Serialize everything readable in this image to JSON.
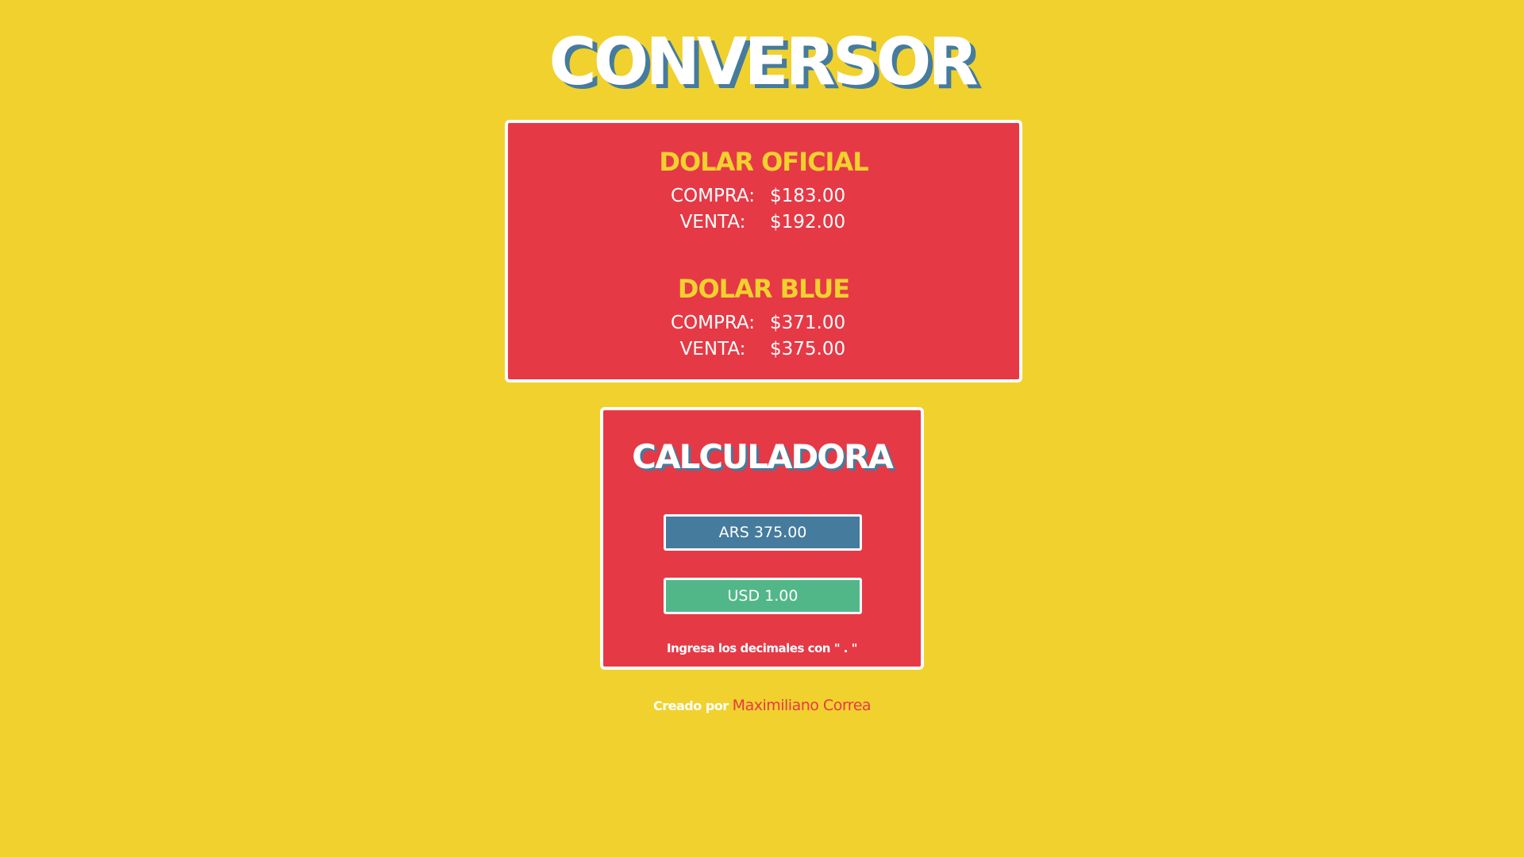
{
  "header": {
    "title": "CONVERSOR"
  },
  "rates": {
    "oficial": {
      "title": "DOLAR OFICIAL",
      "buy_label": "COMPRA:",
      "buy_value": "$183.00",
      "sell_label": "VENTA:",
      "sell_value": "$192.00"
    },
    "blue": {
      "title": "DOLAR BLUE",
      "buy_label": "COMPRA:",
      "buy_value": "$371.00",
      "sell_label": "VENTA:",
      "sell_value": "$375.00"
    }
  },
  "calculator": {
    "title": "CALCULADORA",
    "ars_placeholder": "ARS 375.00",
    "usd_placeholder": "USD 1.00",
    "note": "Ingresa los decimales con \" . \""
  },
  "footer": {
    "prefix": "Creado por",
    "author": "Maximiliano Correa"
  },
  "colors": {
    "background": "#f1d12e",
    "card": "#e63946",
    "ars_field": "#457b9d",
    "usd_field": "#52b788",
    "accent_text": "#f1d12e",
    "shadow": "#457b9d"
  }
}
